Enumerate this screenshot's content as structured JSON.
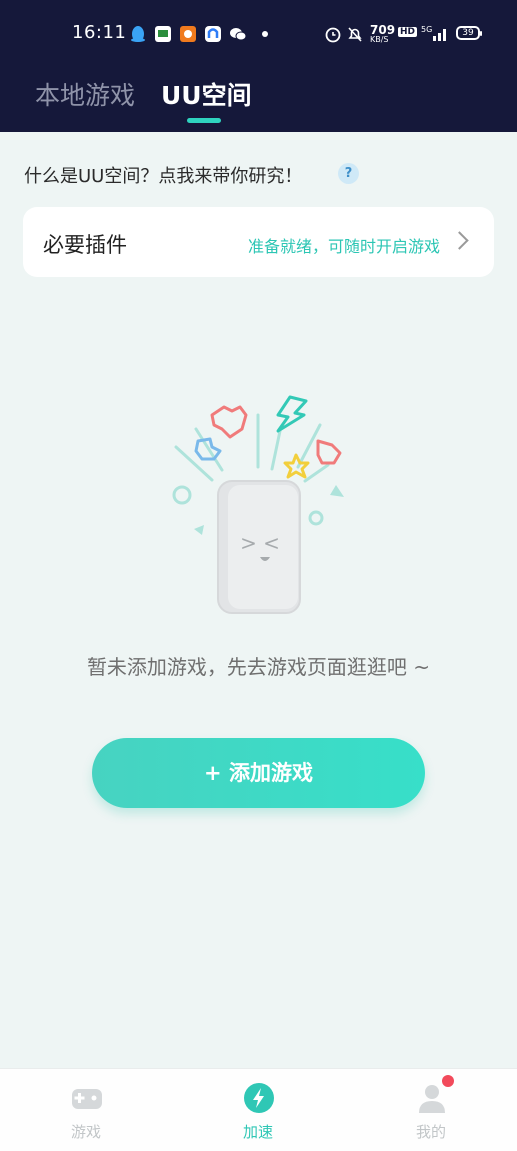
{
  "status_bar": {
    "time": "16:11",
    "network_speed": "709",
    "network_speed_unit": "KB/S",
    "hd": "HD",
    "signal": "5G",
    "battery": "39"
  },
  "header": {
    "tabs": [
      {
        "label": "本地游戏",
        "active": false
      },
      {
        "label": "UU空间",
        "active": true
      }
    ],
    "accent": "#2fd3bf",
    "background": "#15183a"
  },
  "intro": {
    "text": "什么是UU空间？点我来带你研究！",
    "help_icon": "?"
  },
  "plugin_card": {
    "title": "必要插件",
    "status": "准备就绪，可随时开启游戏"
  },
  "empty_state": {
    "face": "> <",
    "message": "暂未添加游戏，先去游戏页面逛逛吧 ~"
  },
  "add_button": {
    "label": "+ 添加游戏"
  },
  "bottom_nav": {
    "items": [
      {
        "label": "游戏",
        "icon": "gamepad-icon",
        "active": false
      },
      {
        "label": "加速",
        "icon": "lightning-icon",
        "active": true
      },
      {
        "label": "我的",
        "icon": "user-icon",
        "active": false
      }
    ],
    "notification_dot_color": "#f24a5b"
  }
}
